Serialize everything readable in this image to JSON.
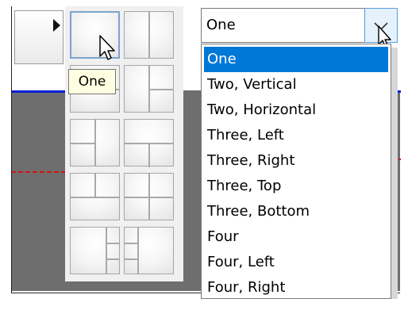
{
  "tooltip": {
    "text": "One"
  },
  "layout_combo": {
    "selected_value": "One",
    "options": [
      "One",
      "Two, Vertical",
      "Two, Horizontal",
      "Three, Left",
      "Three, Right",
      "Three, Top",
      "Three, Bottom",
      "Four",
      "Four, Left",
      "Four, Right"
    ]
  },
  "icons": {
    "corner": "play-arrow-icon",
    "pointer": "mouse-pointer-icon",
    "dropdown": "chevron-down-icon"
  },
  "colors": {
    "selection": "#0078d7",
    "tooltip_bg": "#ffffe1",
    "guide_blue": "#0a1fd6",
    "guide_red": "#d01616"
  }
}
